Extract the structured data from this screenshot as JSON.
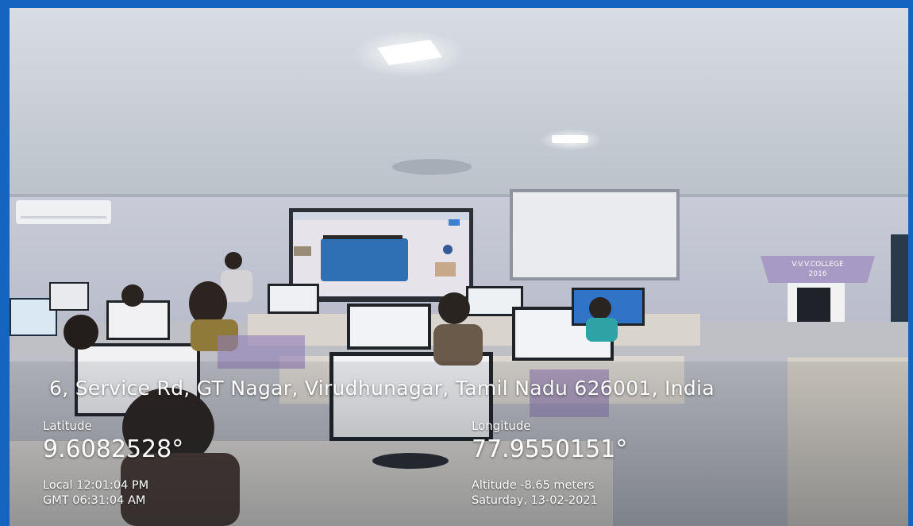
{
  "location": {
    "address": "6, Service Rd, GT Nagar, Virudhunagar, Tamil Nadu 626001, India",
    "latitude_label": "Latitude",
    "latitude_value": "9.6082528°",
    "longitude_label": "Longitude",
    "longitude_value": "77.9550151°",
    "local_time": "Local 12:01:04 PM",
    "gmt_time": "GMT 06:31:04 AM",
    "altitude": "Altitude -8.65 meters",
    "date": "Saturday, 13-02-2021"
  },
  "scene": {
    "podium_text_line1": "V.V.V.COLLEGE",
    "podium_text_line2": "2016"
  },
  "colors": {
    "frame_border": "#1565c0",
    "ceiling": "#cfd6dc",
    "wall": "#c6c9d6",
    "desk": "#d9d4cc"
  }
}
